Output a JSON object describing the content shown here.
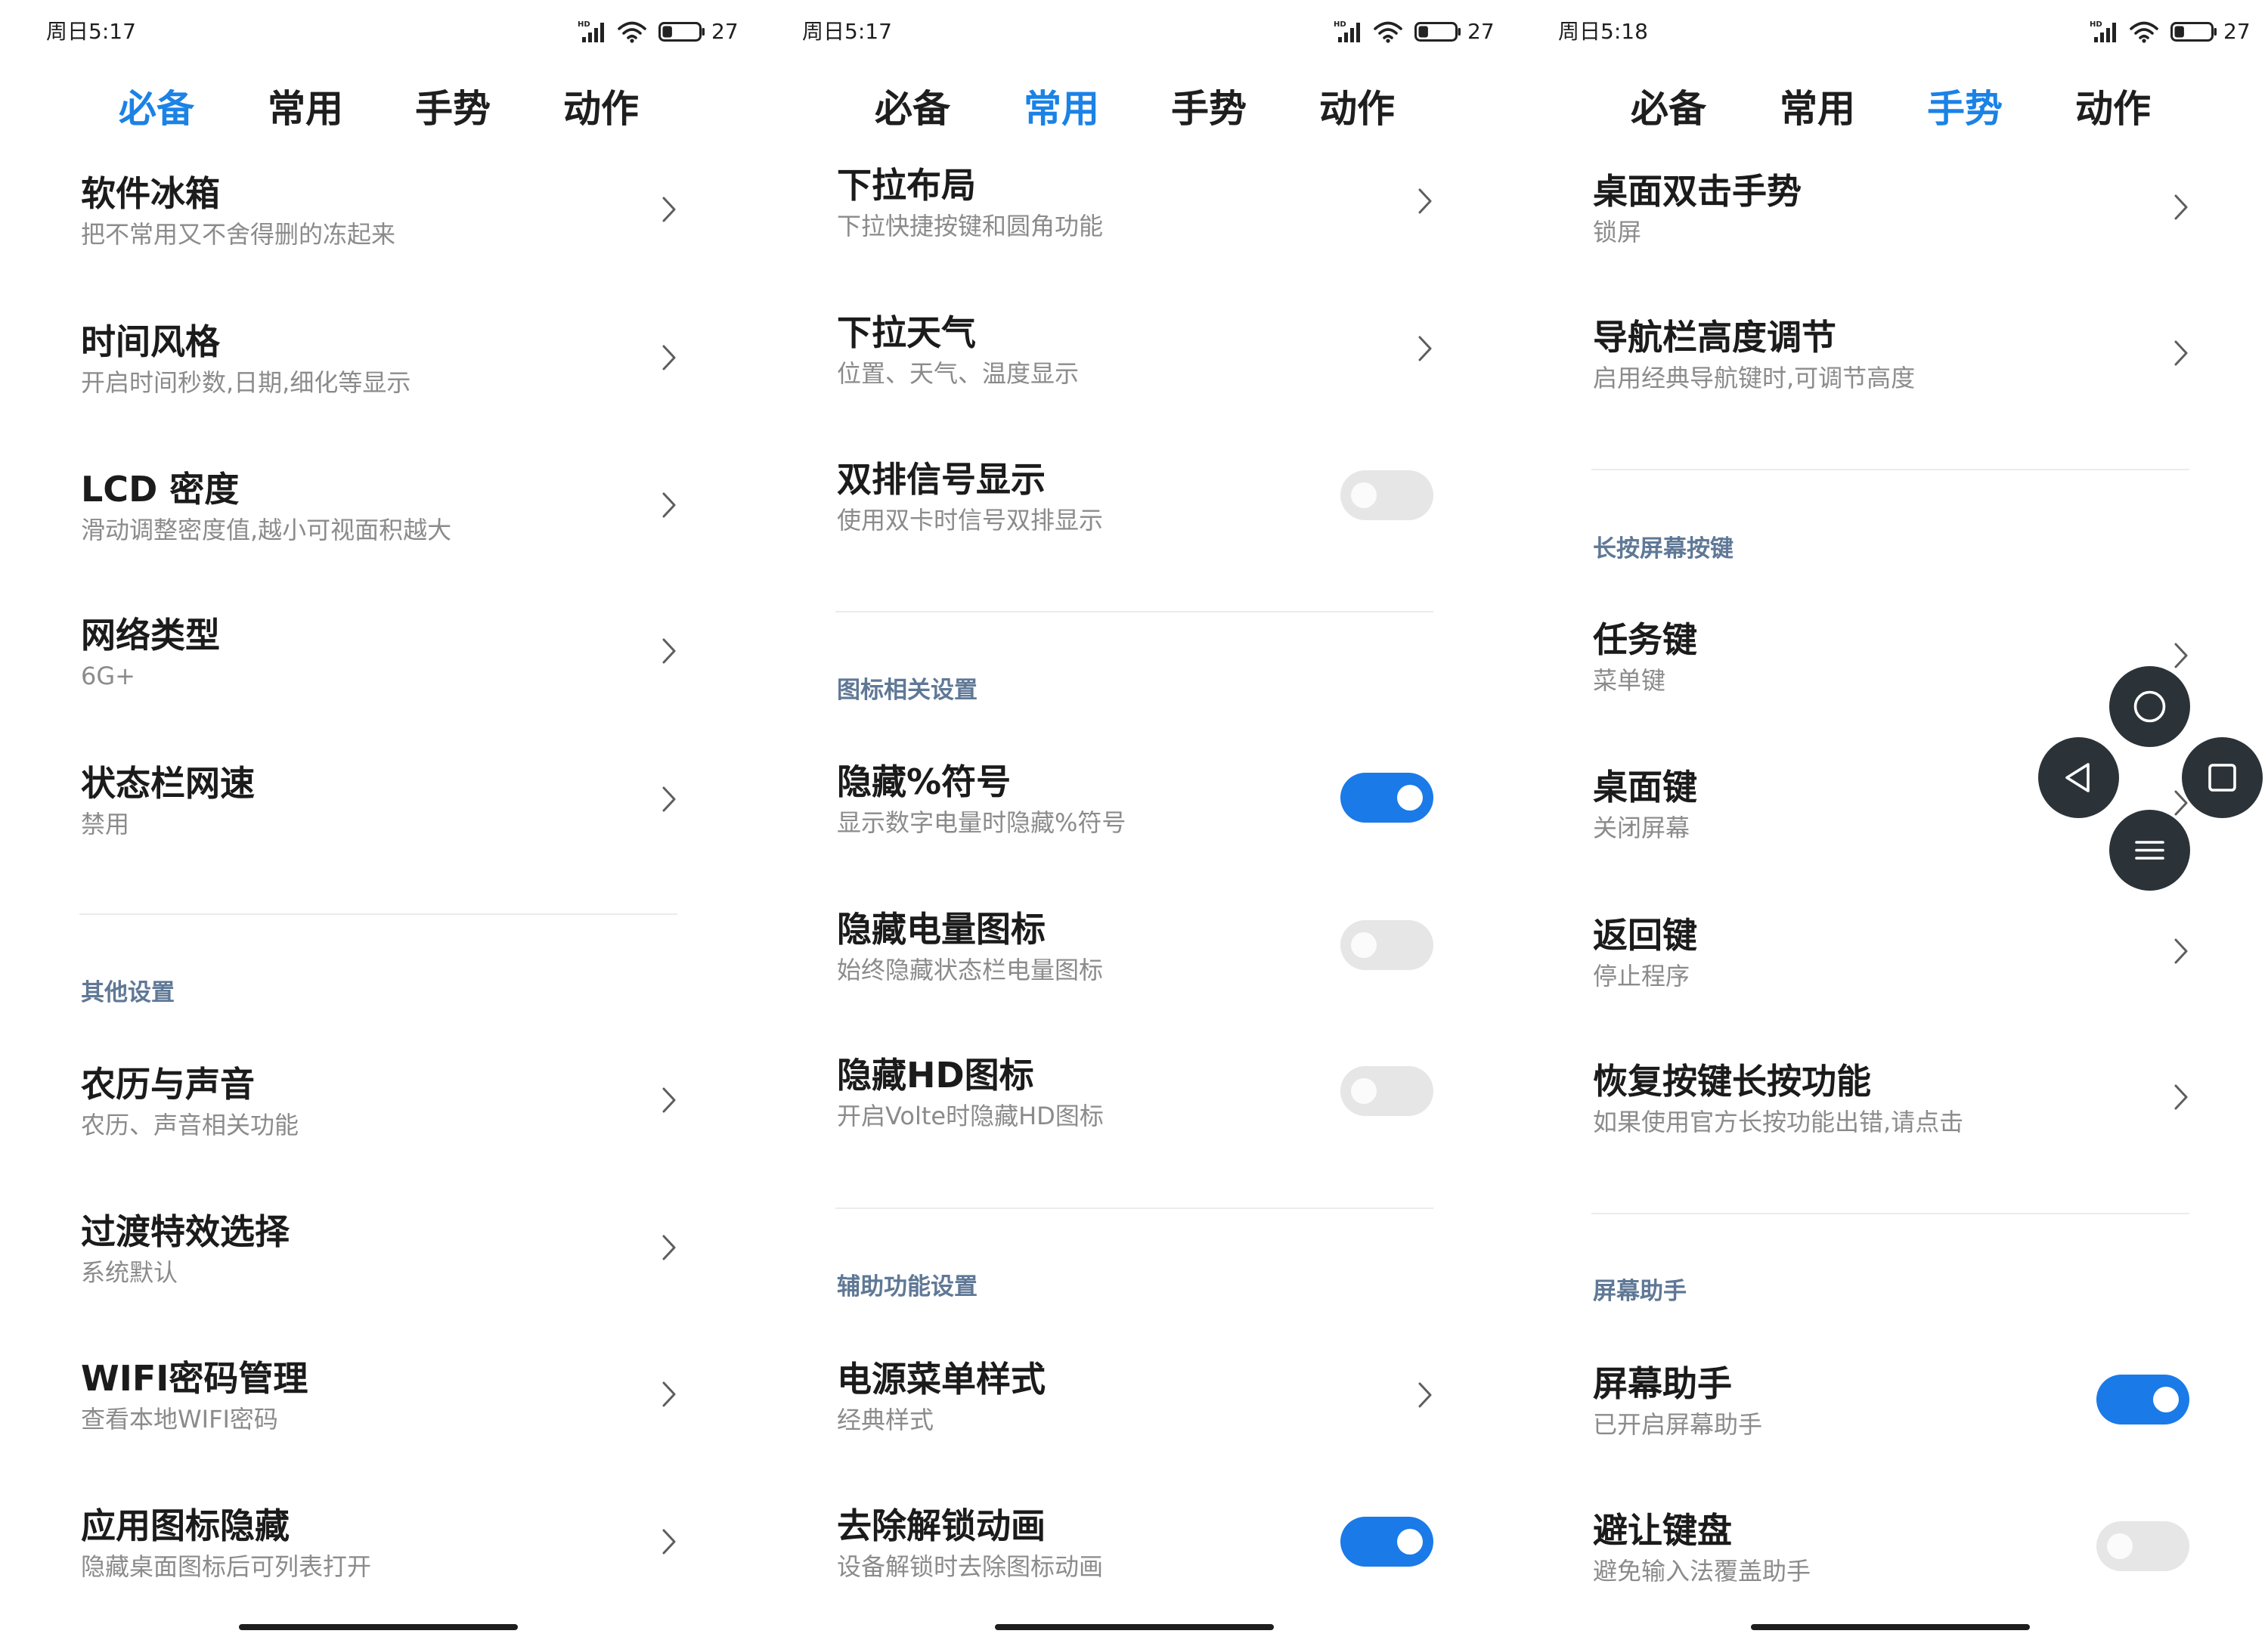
{
  "colors": {
    "accent": "#1b82e6",
    "toggle_on": "#1a7ae8",
    "toggle_off": "#e6e6e6",
    "title_text": "#1b1b1b",
    "subtitle_text": "#8b8b8b",
    "section_text": "#5f7896",
    "floating_button": "#2c3338",
    "background": "#ffffff"
  },
  "status_icons": [
    "hd-signal-icon",
    "wifi-icon",
    "battery-icon"
  ],
  "panels": [
    {
      "status": {
        "time": "周日5:17",
        "signal_label": "HD",
        "battery": "27"
      },
      "tabs": [
        "必备",
        "常用",
        "手势",
        "动作"
      ],
      "active_tab": "必备",
      "items": [
        {
          "title": "软件冰箱",
          "subtitle": "把不常用又不舍得删的冻起来",
          "icon": "chevron-right-icon"
        },
        {
          "title": "时间风格",
          "subtitle": "开启时间秒数,日期,细化等显示",
          "icon": "chevron-right-icon"
        },
        {
          "title": "LCD 密度",
          "subtitle": "滑动调整密度值,越小可视面积越大",
          "icon": "chevron-right-icon"
        },
        {
          "title": "网络类型",
          "subtitle": "6G+",
          "icon": "chevron-right-icon"
        },
        {
          "title": "状态栏网速",
          "subtitle": "禁用",
          "icon": "chevron-right-icon"
        },
        {
          "title": "农历与声音",
          "subtitle": "农历、声音相关功能",
          "icon": "chevron-right-icon"
        },
        {
          "title": "过渡特效选择",
          "subtitle": "系统默认",
          "icon": "chevron-right-icon"
        },
        {
          "title": "WIFI密码管理",
          "subtitle": "查看本地WIFI密码",
          "icon": "chevron-right-icon"
        },
        {
          "title": "应用图标隐藏",
          "subtitle": "隐藏桌面图标后可列表打开",
          "icon": "chevron-right-icon"
        }
      ],
      "sections": [
        "其他设置"
      ]
    },
    {
      "status": {
        "time": "周日5:17",
        "signal_label": "HD",
        "battery": "27"
      },
      "tabs": [
        "必备",
        "常用",
        "手势",
        "动作"
      ],
      "active_tab": "常用",
      "items": [
        {
          "title": "下拉布局",
          "subtitle": "下拉快捷按键和圆角功能",
          "icon": "chevron-right-icon"
        },
        {
          "title": "下拉天气",
          "subtitle": "位置、天气、温度显示",
          "icon": "chevron-right-icon"
        },
        {
          "title": "双排信号显示",
          "subtitle": "使用双卡时信号双排显示",
          "toggle": false
        },
        {
          "title": "隐藏%符号",
          "subtitle": "显示数字电量时隐藏%符号",
          "toggle": true
        },
        {
          "title": "隐藏电量图标",
          "subtitle": "始终隐藏状态栏电量图标",
          "toggle": false
        },
        {
          "title": "隐藏HD图标",
          "subtitle": "开启Volte时隐藏HD图标",
          "toggle": false
        },
        {
          "title": "电源菜单样式",
          "subtitle": "经典样式",
          "icon": "chevron-right-icon"
        },
        {
          "title": "去除解锁动画",
          "subtitle": "设备解锁时去除图标动画",
          "toggle": true
        }
      ],
      "sections": [
        "图标相关设置",
        "辅助功能设置"
      ]
    },
    {
      "status": {
        "time": "周日5:18",
        "signal_label": "HD",
        "battery": "27"
      },
      "tabs": [
        "必备",
        "常用",
        "手势",
        "动作"
      ],
      "active_tab": "手势",
      "items": [
        {
          "title": "桌面双击手势",
          "subtitle": "锁屏",
          "icon": "chevron-right-icon"
        },
        {
          "title": "导航栏高度调节",
          "subtitle": "启用经典导航键时,可调节高度",
          "icon": "chevron-right-icon"
        },
        {
          "title": "任务键",
          "subtitle": "菜单键",
          "icon": "chevron-right-icon"
        },
        {
          "title": "桌面键",
          "subtitle": "关闭屏幕",
          "icon": "chevron-right-icon"
        },
        {
          "title": "返回键",
          "subtitle": "停止程序",
          "icon": "chevron-right-icon"
        },
        {
          "title": "恢复按键长按功能",
          "subtitle": "如果使用官方长按功能出错,请点击",
          "icon": "chevron-right-icon"
        },
        {
          "title": "屏幕助手",
          "subtitle": "已开启屏幕助手",
          "toggle": true
        },
        {
          "title": "避让键盘",
          "subtitle": "避免输入法覆盖助手",
          "toggle": false
        }
      ],
      "sections": [
        "长按屏幕按键",
        "屏幕助手"
      ]
    }
  ],
  "floating_nav": {
    "buttons": [
      "home-circle-icon",
      "back-triangle-icon",
      "recents-square-icon",
      "menu-lines-icon"
    ]
  }
}
